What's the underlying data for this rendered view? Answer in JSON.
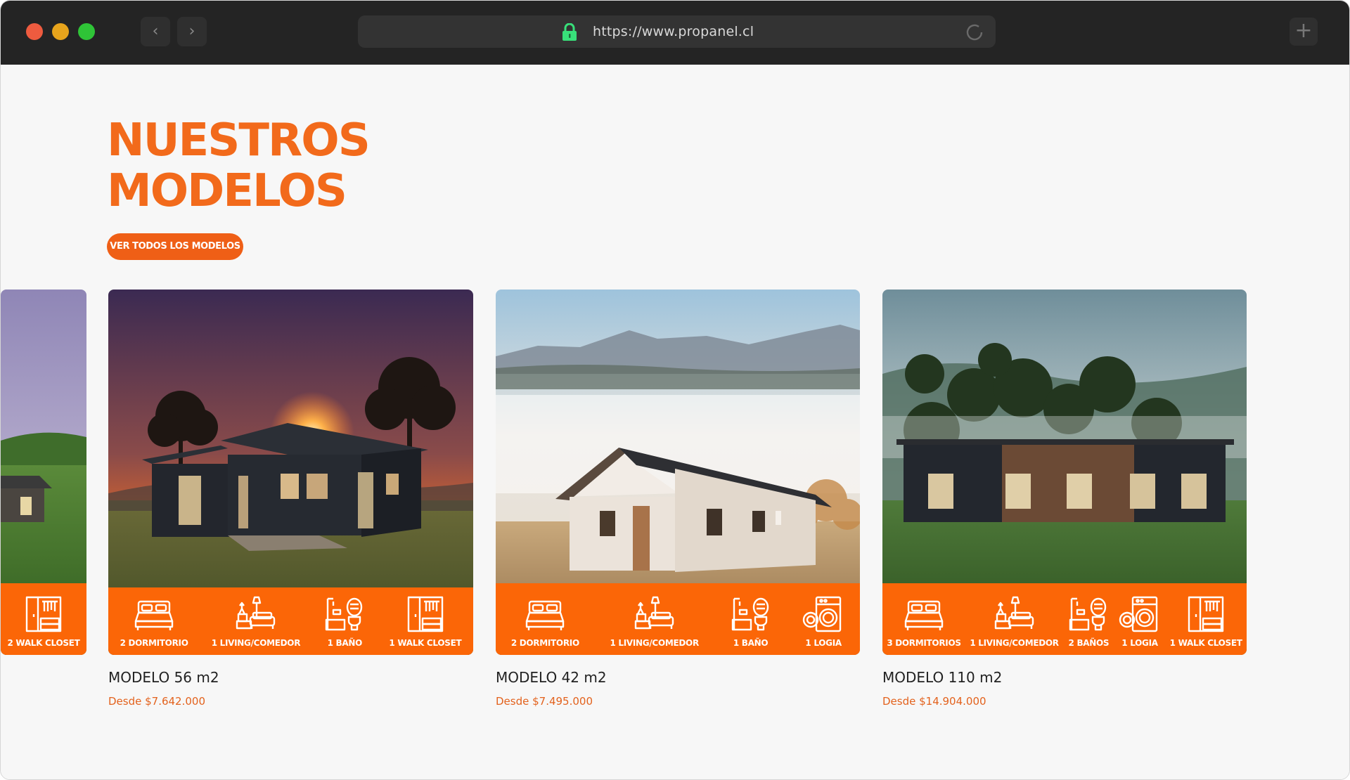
{
  "browser": {
    "url": "https://www.propanel.cl",
    "back_icon": "chevron-left-icon",
    "forward_icon": "chevron-right-icon",
    "new_tab_icon": "plus-icon"
  },
  "section": {
    "title_line1": "NUESTROS",
    "title_line2": "MODELOS",
    "cta_label": "VER TODOS LOS MODELOS"
  },
  "partial_card": {
    "feature_label": "2 WALK CLOSET"
  },
  "cards": [
    {
      "title": "MODELO 56 m2",
      "price": "Desde $7.642.000",
      "features": [
        "2 DORMITORIO",
        "1 LIVING/COMEDOR",
        "1 BAÑO",
        "1 WALK CLOSET"
      ]
    },
    {
      "title": "MODELO 42 m2",
      "price": "Desde $7.495.000",
      "features": [
        "2 DORMITORIO",
        "1 LIVING/COMEDOR",
        "1 BAÑO",
        "1 LOGIA"
      ]
    },
    {
      "title": "MODELO 110 m2",
      "price": "Desde $14.904.000",
      "features": [
        "3 DORMITORIOS",
        "1 LIVING/COMEDOR",
        "2 BAÑOS",
        "1 LOGIA",
        "1 WALK CLOSET"
      ]
    }
  ],
  "colors": {
    "brand_orange": "#f26a1b",
    "feature_bar": "#fb6607",
    "chrome": "#242424"
  }
}
